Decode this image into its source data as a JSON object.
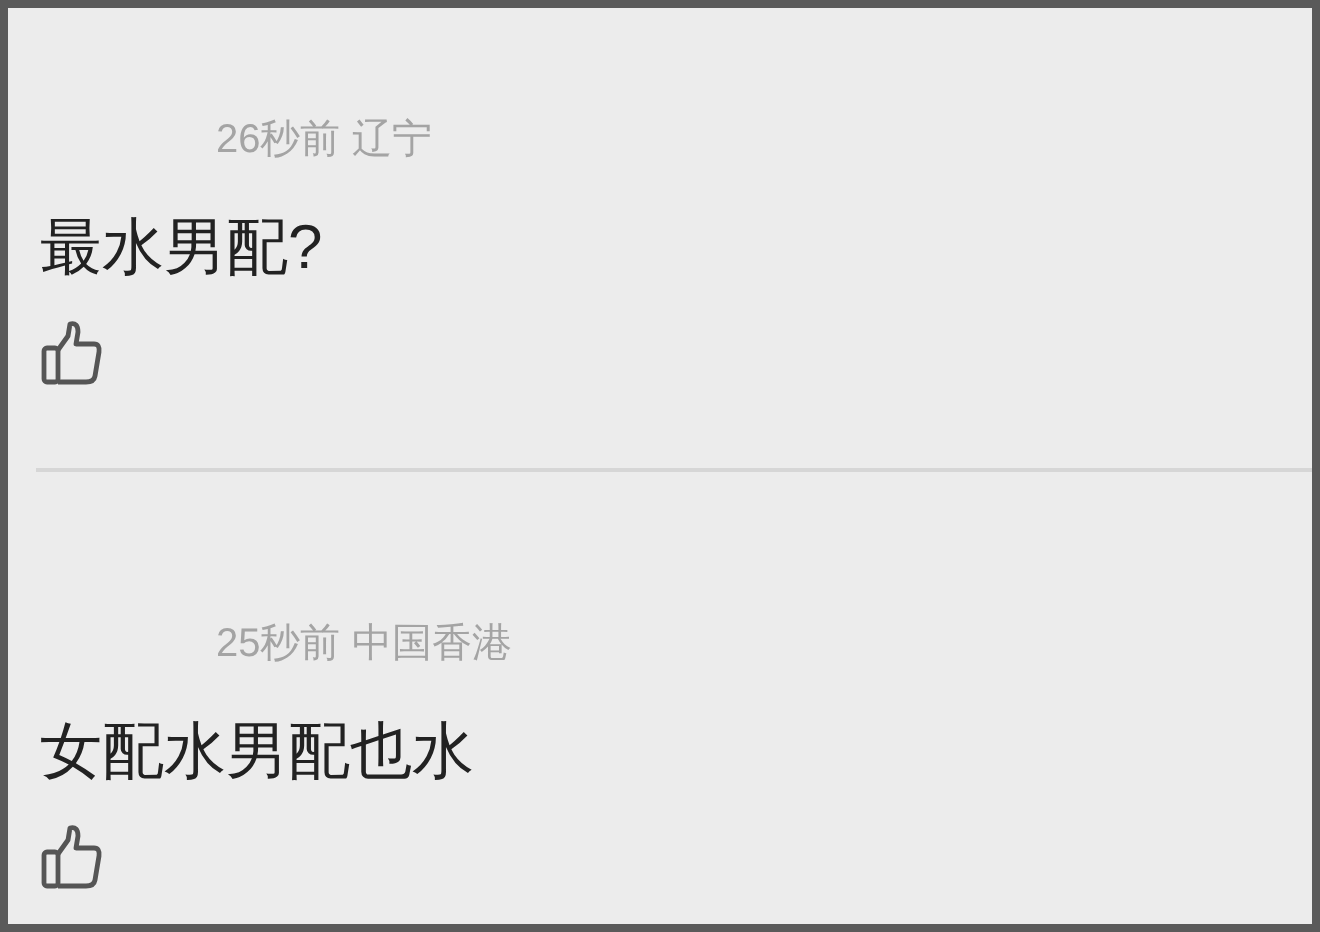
{
  "comments": [
    {
      "meta": "26秒前 辽宁",
      "text": "最水男配?"
    },
    {
      "meta": "25秒前 中国香港",
      "text": "女配水男配也水"
    }
  ]
}
